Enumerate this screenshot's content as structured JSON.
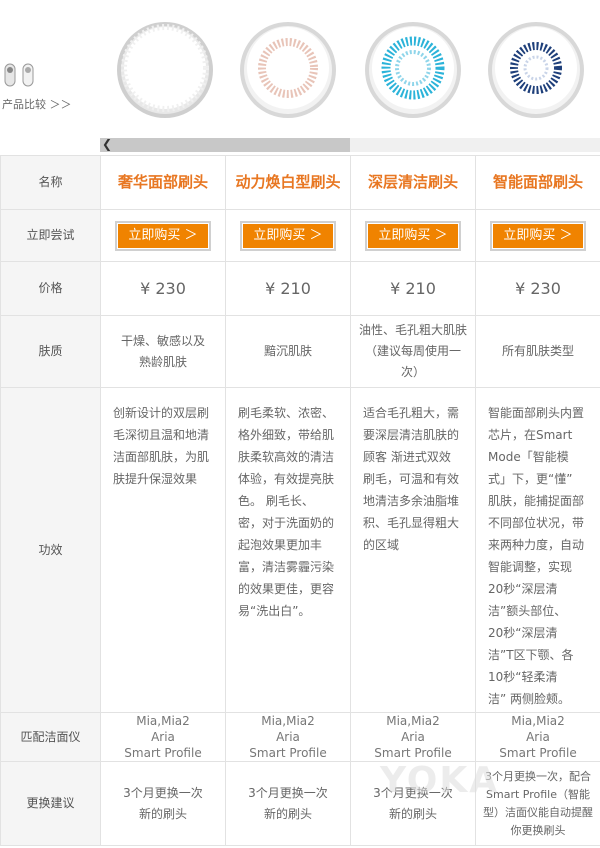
{
  "compare_label": "产品比较 ＞＞",
  "products": [
    {
      "name": "奢华面部刷头",
      "buy_label": "立即购买 ＞",
      "price": "¥ 230",
      "skin": [
        "干燥、敏感以及",
        "熟龄肌肤"
      ],
      "function": [
        "创新设计的双层刷",
        "毛深彻且温和地清",
        "洁面部肌肤，为肌",
        "肤提升保湿效果"
      ],
      "devices": [
        "Mia,Mia2",
        "Aria",
        "Smart Profile"
      ],
      "replace": [
        "3个月更换一次",
        "新的刷头"
      ]
    },
    {
      "name": "动力焕白型刷头",
      "buy_label": "立即购买 ＞",
      "price": "¥ 210",
      "skin": [
        "黯沉肌肤"
      ],
      "function": [
        "刷毛柔软、浓密、",
        "格外细致，带给肌",
        "肤柔软高效的清洁",
        "体验，有效提亮肤",
        "色。 刷毛长、",
        "密，对于洗面奶的",
        "起泡效果更加丰",
        "富，清洁雾霾污染",
        "的效果更佳，更容",
        "易“洗出白”。"
      ],
      "devices": [
        "Mia,Mia2",
        "Aria",
        "Smart Profile"
      ],
      "replace": [
        "3个月更换一次",
        "新的刷头"
      ]
    },
    {
      "name": "深层清洁刷头",
      "buy_label": "立即购买 ＞",
      "price": "¥ 210",
      "skin": [
        "油性、毛孔粗大肌肤",
        "（建议每周使用一次）"
      ],
      "function": [
        "适合毛孔粗大，需",
        "要深层清洁肌肤的",
        "顾客 渐进式双效",
        "刷毛，可温和有效",
        "地清洁多余油脂堆",
        "积、毛孔显得粗大",
        "的区域"
      ],
      "devices": [
        "Mia,Mia2",
        "Aria",
        "Smart Profile"
      ],
      "replace": [
        "3个月更换一次",
        "新的刷头"
      ]
    },
    {
      "name": "智能面部刷头",
      "buy_label": "立即购买 ＞",
      "price": "¥ 230",
      "skin": [
        "所有肌肤类型"
      ],
      "function": [
        "智能面部刷头内置",
        "芯片，在Smart",
        "Mode「智能模",
        "式」下，更“懂”",
        "肌肤，能捕捉面部",
        "不同部位状况，带",
        "来两种力度，自动",
        "智能调整，实现",
        "20秒“深层清",
        "洁”额头部位、",
        "20秒“深层清",
        "洁”T区下颚、各",
        "10秒“轻柔清",
        "洁” 两侧脸颊。"
      ],
      "devices": [
        "Mia,Mia2",
        "Aria",
        "Smart Profile"
      ],
      "replace": [
        "3个月更换一次，配合",
        "Smart Profile（智能",
        "型）洁面仪能自动提醒",
        "你更换刷头"
      ]
    }
  ],
  "rows": {
    "name": "名称",
    "try": "立即尝试",
    "price": "价格",
    "skin": "肤质",
    "function": "功效",
    "devices": "匹配洁面仪",
    "replace": "更换建议"
  },
  "watermark": "YOKA",
  "colors": {
    "accent": "#f08300",
    "name_text": "#e87722"
  }
}
